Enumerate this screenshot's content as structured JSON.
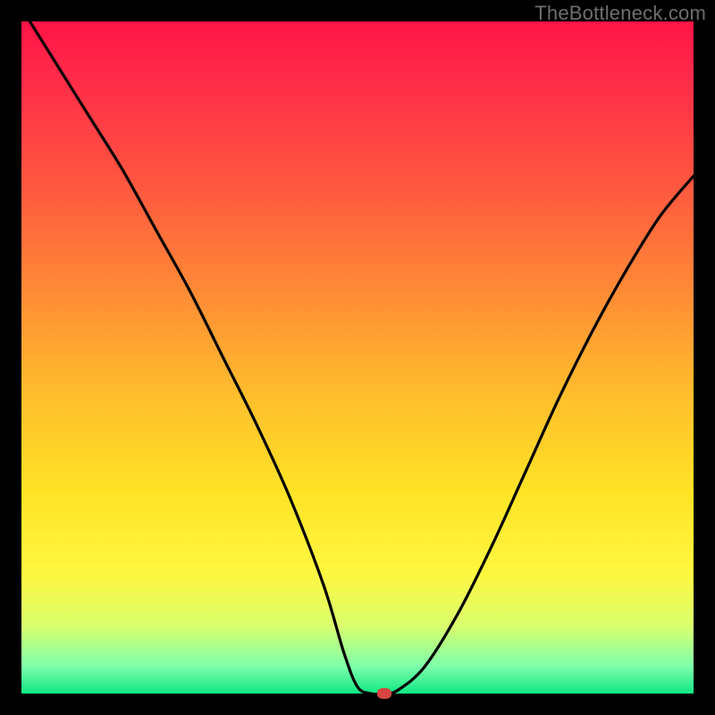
{
  "watermark": "TheBottleneck.com",
  "chart_data": {
    "type": "line",
    "title": "",
    "xlabel": "",
    "ylabel": "",
    "xlim": [
      0,
      100
    ],
    "ylim": [
      0,
      100
    ],
    "x": [
      0,
      5,
      10,
      15,
      20,
      25,
      30,
      35,
      40,
      45,
      48,
      50,
      52,
      54,
      56,
      60,
      65,
      70,
      75,
      80,
      85,
      90,
      95,
      100
    ],
    "y": [
      102,
      94,
      86,
      78,
      69,
      60,
      50,
      40,
      29,
      16,
      6,
      1,
      0,
      0,
      0.5,
      4,
      12,
      22,
      33,
      44,
      54,
      63,
      71,
      77
    ],
    "marker": {
      "x": 54,
      "y": 0
    },
    "background_gradient": [
      "#ff1446",
      "#ff8a36",
      "#ffe326",
      "#10e884"
    ]
  }
}
